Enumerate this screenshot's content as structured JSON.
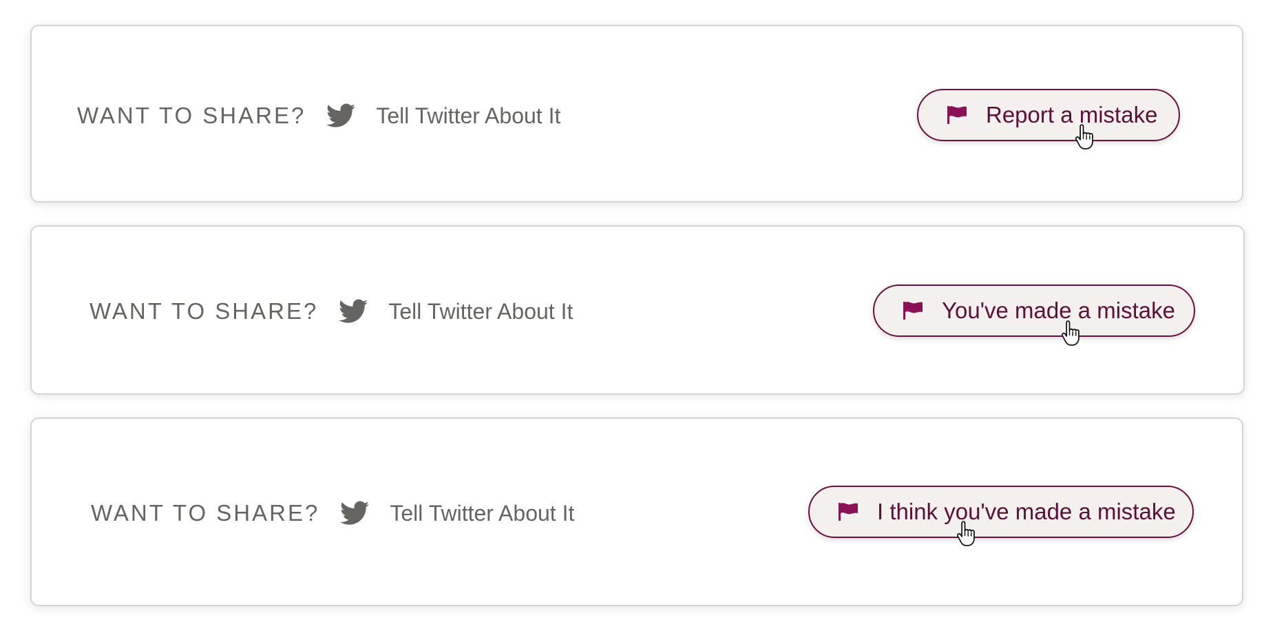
{
  "colors": {
    "accent": "#5c0f37",
    "flag": "#8b1156",
    "text_muted": "#666461",
    "button_bg": "#f3f0ed",
    "card_border": "#d4d4d4"
  },
  "icons": {
    "share": "twitter-bird-icon",
    "button": "flag-icon",
    "pointer": "hand-pointer-cursor-icon"
  },
  "cards": [
    {
      "share_label": "WANT TO SHARE?",
      "share_link": "Tell Twitter About It",
      "button_label": "Report a mistake"
    },
    {
      "share_label": "WANT TO SHARE?",
      "share_link": "Tell Twitter About It",
      "button_label": "You've made a mistake"
    },
    {
      "share_label": "WANT TO SHARE?",
      "share_link": "Tell Twitter About It",
      "button_label": "I think you've made a mistake"
    }
  ]
}
